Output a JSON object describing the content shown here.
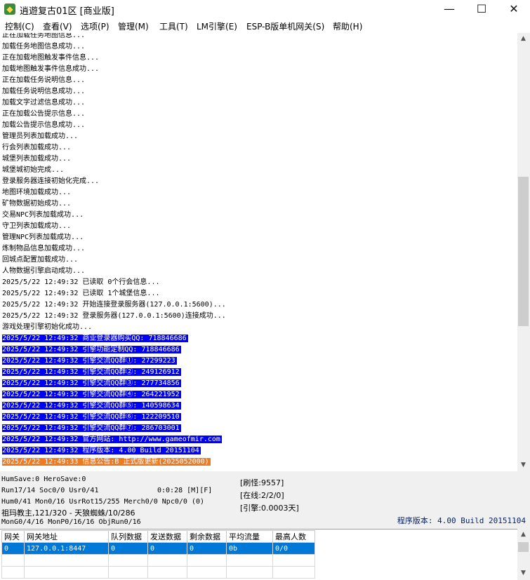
{
  "window": {
    "title": "逍遊复古01区 [商业版]",
    "minimize": "—",
    "maximize": "☐",
    "close": "✕"
  },
  "menu": [
    "控制(C)",
    "查看(V)",
    "选项(P)",
    "管理(M)",
    "工具(T)",
    "LM引擎(E)",
    "ESP-B版单机网关(S)",
    "帮助(H)"
  ],
  "log": [
    {
      "text": "正在加载任务地图信息...",
      "style": "normal"
    },
    {
      "text": "加载任务地图信息成功...",
      "style": "normal"
    },
    {
      "text": "正在加载地图触发事件信息...",
      "style": "normal"
    },
    {
      "text": "加载地图触发事件信息成功...",
      "style": "normal"
    },
    {
      "text": "正在加载任务说明信息...",
      "style": "normal"
    },
    {
      "text": "加载任务说明信息成功...",
      "style": "normal"
    },
    {
      "text": "加载文字过滤信息成功...",
      "style": "normal"
    },
    {
      "text": "正在加载公告提示信息...",
      "style": "normal"
    },
    {
      "text": "加载公告提示信息成功...",
      "style": "normal"
    },
    {
      "text": "管理员列表加载成功...",
      "style": "normal"
    },
    {
      "text": "行会列表加载成功...",
      "style": "normal"
    },
    {
      "text": "城堡列表加载成功...",
      "style": "normal"
    },
    {
      "text": "城堡城初始完成...",
      "style": "normal"
    },
    {
      "text": "登录服务器连接初始化完成...",
      "style": "normal"
    },
    {
      "text": "地图环境加载成功...",
      "style": "normal"
    },
    {
      "text": "矿物数据初始成功...",
      "style": "normal"
    },
    {
      "text": "交易NPC列表加载成功...",
      "style": "normal"
    },
    {
      "text": "守卫列表加载成功...",
      "style": "normal"
    },
    {
      "text": "管理NPC列表加载成功...",
      "style": "normal"
    },
    {
      "text": "炼制物品信息加载成功...",
      "style": "normal"
    },
    {
      "text": "回城点配置加载成功...",
      "style": "normal"
    },
    {
      "text": "人物数据引擎启动成功...",
      "style": "normal"
    },
    {
      "text": "2025/5/22 12:49:32 已读取 0个行会信息...",
      "style": "normal"
    },
    {
      "text": "2025/5/22 12:49:32 已读取 1个城堡信息...",
      "style": "normal"
    },
    {
      "text": "2025/5/22 12:49:32 开始连接登录服务器(127.0.0.1:5600)...",
      "style": "normal"
    },
    {
      "text": "2025/5/22 12:49:32 登录服务器(127.0.0.1:5600)连接成功...",
      "style": "normal"
    },
    {
      "text": "游戏处理引擎初始化成功...",
      "style": "normal"
    },
    {
      "text": "2025/5/22 12:49:32 商业登录器购买QQ: 718846686",
      "style": "sel"
    },
    {
      "text": "2025/5/22 12:49:32 引擎功能定制QQ: 718846686",
      "style": "sel"
    },
    {
      "text": "2025/5/22 12:49:32 引擎交流QQ群①: 27299223",
      "style": "sel"
    },
    {
      "text": "2025/5/22 12:49:32 引擎交流QQ群②: 249126912",
      "style": "sel"
    },
    {
      "text": "2025/5/22 12:49:32 引擎交流QQ群③: 277734856",
      "style": "sel"
    },
    {
      "text": "2025/5/22 12:49:32 引擎交流QQ群④: 264221952",
      "style": "sel"
    },
    {
      "text": "2025/5/22 12:49:32 引擎交流QQ群⑤: 140598634",
      "style": "sel"
    },
    {
      "text": "2025/5/22 12:49:32 引擎交流QQ群⑥: 122209510",
      "style": "sel"
    },
    {
      "text": "2025/5/22 12:49:32 引擎交流QQ群⑦: 286703001",
      "style": "sel"
    },
    {
      "text": "2025/5/22 12:49:32 官方网站: http://www.gameofmir.com",
      "style": "sel"
    },
    {
      "text": "2025/5/22 12:49:32 程序版本: 4.00 Build 20151104",
      "style": "sel"
    },
    {
      "text": "2025/5/22 12:49:33 信息公告:B 正式版更新(2025052000)",
      "style": "orange"
    }
  ],
  "status": {
    "line1": "HumSave:0 HeroSave:0",
    "line2": "Run17/14 Soc0/0 Usr0/41",
    "timer": "0:0:28 [M][F]",
    "line3": "Hum0/41 Mon0/16 UsrRot15/255 Merch0/0 Npc0/0 (0)",
    "line4": "祖玛教主,121/320 - 天狼蜘蛛/10/286",
    "line5": "MonG0/4/16 MonP0/16/16 ObjRun0/16",
    "refresh": "[刷怪:9557]",
    "online": "[在线:2/2/0]",
    "engine": "[引擎:0.0003天]",
    "version": "程序版本: 4.00 Build 20151104"
  },
  "gateway_table": {
    "columns": [
      "网关",
      "网关地址",
      "队列数据",
      "发送数据",
      "剩余数据",
      "平均流量",
      "最高人数"
    ],
    "rows": [
      [
        "0",
        "127.0.0.1:8447",
        "0",
        "0",
        "0",
        "0b",
        "0/0"
      ]
    ]
  }
}
